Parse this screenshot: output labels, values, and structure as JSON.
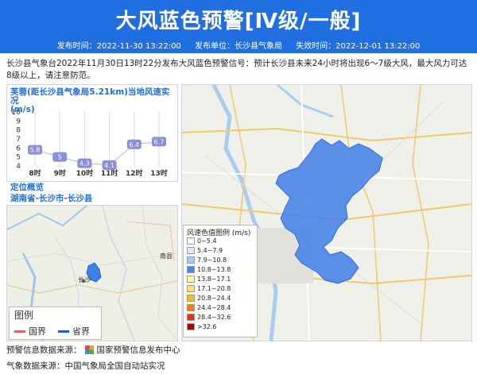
{
  "header": {
    "title": "大风蓝色预警[Ⅳ级/一般]",
    "publish_time": "发布时间：2022-11-30 13:22:00",
    "publisher": "发布单位：长沙县气象局",
    "expire_time": "失效时间：2022-12-01 13:22:00"
  },
  "description": "长沙县气象台2022年11月30日13时22分发布大风蓝色预警信号：预计长沙县未来24小时将出现6～7级大风，最大风力可达8级以上，请注意防范。",
  "chart_panel": {
    "title": "芙蓉(距长沙县气象局5.21km)当地风速实况",
    "unit": "(m/s)"
  },
  "chart_data": {
    "type": "line",
    "categories": [
      "8时",
      "9时",
      "10时",
      "11时",
      "12时",
      "13时"
    ],
    "values": [
      5.8,
      5,
      4.3,
      4.1,
      6.4,
      6.7
    ],
    "ylim": [
      4,
      10
    ],
    "yticks": [
      "4",
      "5",
      "6",
      "7",
      "8",
      "9",
      "10"
    ],
    "grid": true,
    "color": "#8a8fd6"
  },
  "location": {
    "title": "定位概览",
    "region": "湖南省-长沙市-长沙县",
    "city_label": "长沙",
    "town_label": "南县",
    "legend_title": "图例",
    "legend_items": [
      {
        "label": "国界",
        "color": "#d9607a"
      },
      {
        "label": "省界",
        "color": "#1f5bd0"
      }
    ]
  },
  "wind_legend": {
    "title": "风速色值图例 (m/s)",
    "items": [
      {
        "label": "0~5.4",
        "color": "#ffffff"
      },
      {
        "label": "5.4~7.9",
        "color": "#dbe8fb"
      },
      {
        "label": "7.9~10.8",
        "color": "#a9c8f4"
      },
      {
        "label": "10.8~13.8",
        "color": "#4b86e8"
      },
      {
        "label": "13.8~17.1",
        "color": "#fff7b0"
      },
      {
        "label": "17.1~20.8",
        "color": "#ffe27a"
      },
      {
        "label": "20.8~24.4",
        "color": "#f7b733"
      },
      {
        "label": "24.4~28.4",
        "color": "#ef7d1a"
      },
      {
        "label": "28.4~32.6",
        "color": "#d93a12"
      },
      {
        "label": ">32.6",
        "color": "#9b0d0d"
      }
    ]
  },
  "footer": {
    "warning_source": "预警信息数据来源：",
    "warning_source_name": "国家预警信息发布中心",
    "weather_source": "气象数据来源：中国气象局全国自动站实况"
  },
  "colors": {
    "header_bg": "#1f6fe0",
    "region_fill": "#3f7fe8"
  }
}
